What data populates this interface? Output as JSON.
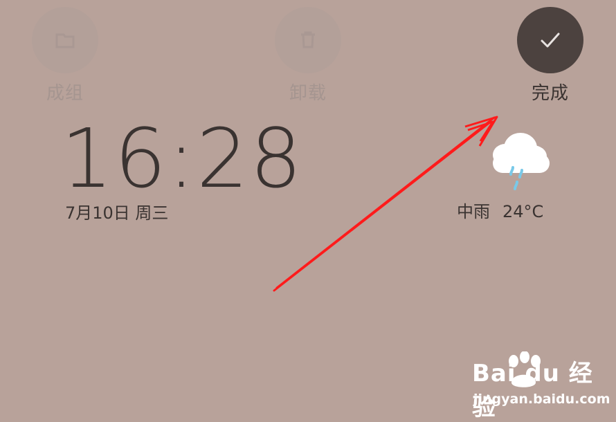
{
  "actions": [
    {
      "label": "成组",
      "icon": "folder-icon",
      "state": "disabled"
    },
    {
      "label": "卸载",
      "icon": "trash-icon",
      "state": "disabled"
    },
    {
      "label": "完成",
      "icon": "check-icon",
      "state": "active"
    }
  ],
  "clock": {
    "time": "16:28",
    "date": "7月10日 周三"
  },
  "weather": {
    "condition": "中雨",
    "temperature": "24°C",
    "icon": "cloud-rain-icon"
  },
  "annotation": {
    "arrow_color": "#ff0000",
    "target": "完成"
  },
  "watermark": {
    "brand": "Bai du 经验",
    "url": "jingyan.baidu.com"
  },
  "colors": {
    "background": "#b8a29a",
    "disabled_fill": "#b3a099",
    "active_fill": "#4c423f",
    "text": "#3a3331",
    "rain": "#79c9e8"
  }
}
